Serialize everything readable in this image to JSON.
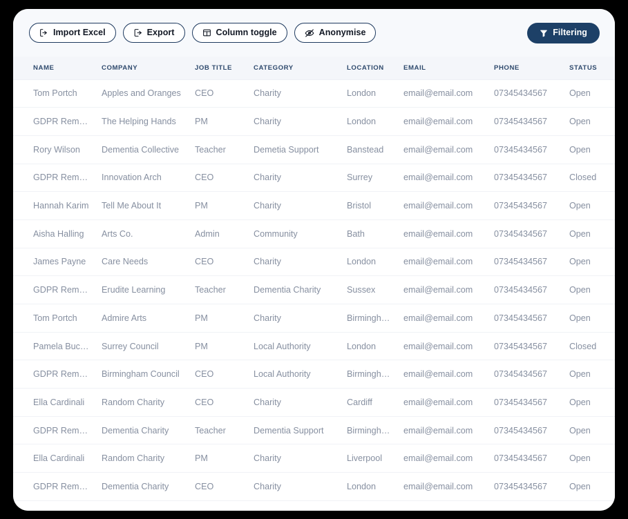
{
  "colors": {
    "page_background": "#000000",
    "card_background": "#ffffff",
    "toolbar_background": "#f7f9fc",
    "header_background": "#f4f6fa",
    "header_text": "#2f4a6d",
    "cell_text": "#868fa0",
    "button_border": "#1e3a5f",
    "button_text": "#121824",
    "primary_button_background": "#1d4067",
    "primary_button_text": "#ffffff",
    "row_divider": "#f0f2f6"
  },
  "toolbar": {
    "buttons": [
      {
        "id": "import-excel",
        "label": "Import Excel",
        "icon": "import-icon"
      },
      {
        "id": "export",
        "label": "Export",
        "icon": "export-icon"
      },
      {
        "id": "column-toggle",
        "label": "Column toggle",
        "icon": "columns-icon"
      },
      {
        "id": "anonymise",
        "label": "Anonymise",
        "icon": "eye-off-icon"
      }
    ],
    "filtering": {
      "id": "filtering",
      "label": "Filtering",
      "icon": "funnel-icon"
    }
  },
  "table": {
    "columns": [
      {
        "key": "name",
        "label": "NAME"
      },
      {
        "key": "company",
        "label": "COMPANY"
      },
      {
        "key": "jobtitle",
        "label": "JOB TITLE"
      },
      {
        "key": "category",
        "label": "CATEGORY"
      },
      {
        "key": "location",
        "label": "LOCATION"
      },
      {
        "key": "email",
        "label": "EMAIL"
      },
      {
        "key": "phone",
        "label": "PHONE"
      },
      {
        "key": "status",
        "label": "STATUS"
      }
    ],
    "rows": [
      {
        "name": "Tom Portch",
        "company": "Apples and Oranges",
        "jobtitle": "CEO",
        "category": "Charity",
        "location": "London",
        "email": "email@email.com",
        "phone": "07345434567",
        "status": "Open"
      },
      {
        "name": "GDPR Removed",
        "company": "The Helping Hands",
        "jobtitle": "PM",
        "category": "Charity",
        "location": "London",
        "email": "email@email.com",
        "phone": "07345434567",
        "status": "Open"
      },
      {
        "name": "Rory Wilson",
        "company": "Dementia Collective",
        "jobtitle": "Teacher",
        "category": "Demetia Support",
        "location": "Banstead",
        "email": "email@email.com",
        "phone": "07345434567",
        "status": "Open"
      },
      {
        "name": "GDPR Removed",
        "company": "Innovation Arch",
        "jobtitle": "CEO",
        "category": "Charity",
        "location": "Surrey",
        "email": "email@email.com",
        "phone": "07345434567",
        "status": "Closed"
      },
      {
        "name": "Hannah Karim",
        "company": "Tell Me About It",
        "jobtitle": "PM",
        "category": "Charity",
        "location": "Bristol",
        "email": "email@email.com",
        "phone": "07345434567",
        "status": "Open"
      },
      {
        "name": "Aisha Halling",
        "company": "Arts Co.",
        "jobtitle": "Admin",
        "category": "Community",
        "location": "Bath",
        "email": "email@email.com",
        "phone": "07345434567",
        "status": "Open"
      },
      {
        "name": "James Payne",
        "company": "Care Needs",
        "jobtitle": "CEO",
        "category": "Charity",
        "location": "London",
        "email": "email@email.com",
        "phone": "07345434567",
        "status": "Open"
      },
      {
        "name": "GDPR Removed",
        "company": "Erudite Learning",
        "jobtitle": "Teacher",
        "category": "Dementia Charity",
        "location": "Sussex",
        "email": "email@email.com",
        "phone": "07345434567",
        "status": "Open"
      },
      {
        "name": "Tom Portch",
        "company": "Admire Arts",
        "jobtitle": "PM",
        "category": "Charity",
        "location": "Birmingham",
        "email": "email@email.com",
        "phone": "07345434567",
        "status": "Open"
      },
      {
        "name": "Pamela Buckley",
        "company": "Surrey Council",
        "jobtitle": "PM",
        "category": "Local Authority",
        "location": "London",
        "email": "email@email.com",
        "phone": "07345434567",
        "status": "Closed"
      },
      {
        "name": "GDPR Removed",
        "company": "Birmingham Council",
        "jobtitle": "CEO",
        "category": "Local Authority",
        "location": "Birmingham",
        "email": "email@email.com",
        "phone": "07345434567",
        "status": "Open"
      },
      {
        "name": "Ella Cardinali",
        "company": "Random Charity",
        "jobtitle": "CEO",
        "category": "Charity",
        "location": "Cardiff",
        "email": "email@email.com",
        "phone": "07345434567",
        "status": "Open"
      },
      {
        "name": "GDPR Removed",
        "company": "Dementia Charity",
        "jobtitle": "Teacher",
        "category": "Dementia Support",
        "location": "Birmingham",
        "email": "email@email.com",
        "phone": "07345434567",
        "status": "Open"
      },
      {
        "name": "Ella Cardinali",
        "company": "Random Charity",
        "jobtitle": "PM",
        "category": "Charity",
        "location": "Liverpool",
        "email": "email@email.com",
        "phone": "07345434567",
        "status": "Open"
      },
      {
        "name": "GDPR Removed",
        "company": "Dementia Charity",
        "jobtitle": "CEO",
        "category": "Charity",
        "location": "London",
        "email": "email@email.com",
        "phone": "07345434567",
        "status": "Open"
      }
    ]
  }
}
